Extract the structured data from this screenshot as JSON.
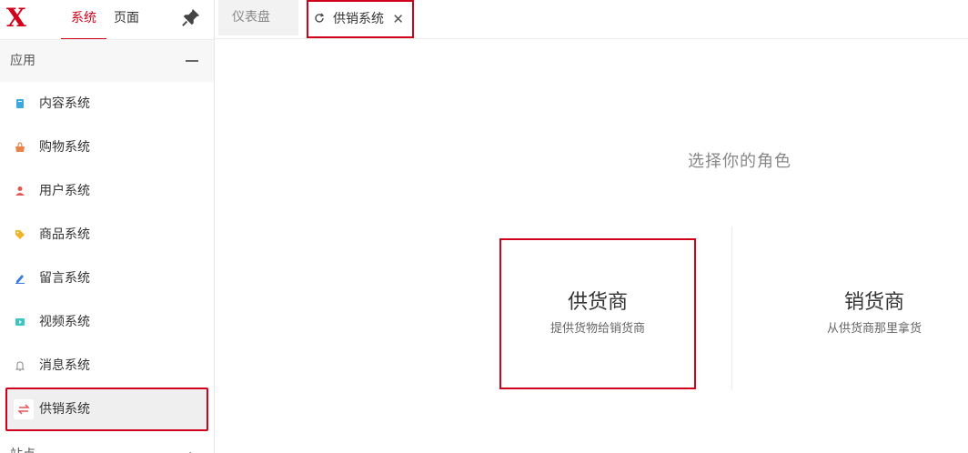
{
  "brand": {
    "logo_text": "X",
    "color": "#d0021b"
  },
  "sidebar": {
    "tabs": [
      {
        "label": "系统",
        "active": true
      },
      {
        "label": "页面",
        "active": false
      }
    ],
    "section_apps": "应用",
    "items": [
      {
        "label": "内容系统",
        "icon": "document-icon",
        "color": "#3ba8e0"
      },
      {
        "label": "购物系统",
        "icon": "shopping-bag-icon",
        "color": "#e8834a"
      },
      {
        "label": "用户系统",
        "icon": "user-icon",
        "color": "#e35656"
      },
      {
        "label": "商品系统",
        "icon": "tag-icon",
        "color": "#f0b429"
      },
      {
        "label": "留言系统",
        "icon": "pen-icon",
        "color": "#3a7be0"
      },
      {
        "label": "视频系统",
        "icon": "video-icon",
        "color": "#3cc6c0"
      },
      {
        "label": "消息系统",
        "icon": "bell-icon",
        "color": "#888888"
      },
      {
        "label": "供销系统",
        "icon": "exchange-icon",
        "color": "#e35656",
        "active": true
      }
    ],
    "section_sites": "站点"
  },
  "tabs": {
    "dashboard": "仪表盘",
    "active": "供销系统"
  },
  "content": {
    "prompt": "选择你的角色",
    "supplier": {
      "title": "供货商",
      "desc": "提供货物给销货商"
    },
    "seller": {
      "title": "销货商",
      "desc": "从供货商那里拿货"
    }
  }
}
